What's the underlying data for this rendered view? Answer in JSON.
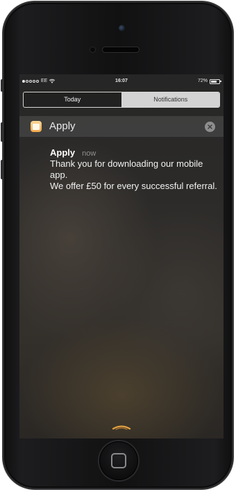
{
  "status_bar": {
    "carrier": "EE",
    "time": "16:07",
    "battery": "72%",
    "battery_level": 0.72,
    "signal_bars_filled": 1,
    "signal_bars_total": 5
  },
  "segmented_control": {
    "today_label": "Today",
    "notifications_label": "Notifications",
    "selected": "Notifications"
  },
  "app_row": {
    "app_name": "Apply",
    "icon": "apply-app-icon"
  },
  "notification": {
    "title": "Apply",
    "time": "now",
    "body": "Thank you for downloading our mobile app.\nWe offer £50 for every successful referral."
  },
  "icons": {
    "wifi": "wifi-icon",
    "battery": "battery-icon",
    "close": "close-icon",
    "grabber": "grabber-handle-icon",
    "home": "home-button-icon"
  },
  "colors": {
    "selected_segment_bg": "#d3d3d3",
    "app_icon_orange": "#f0a848",
    "grabber": "#e0a040"
  }
}
